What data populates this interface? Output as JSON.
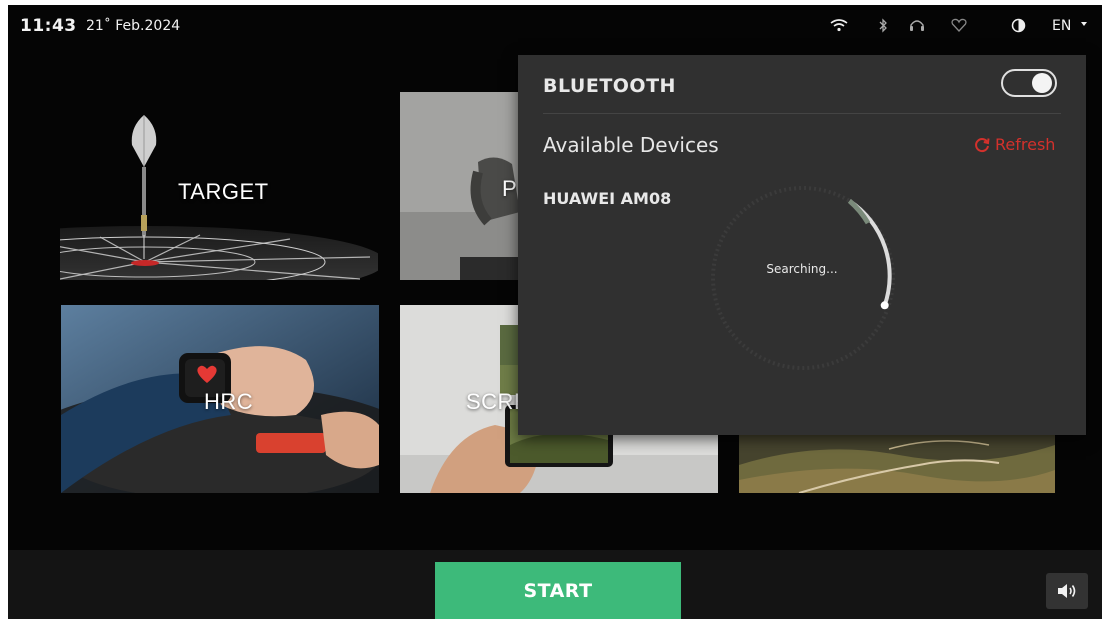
{
  "status_bar": {
    "time": "11:43",
    "date": "21˚ Feb.2024",
    "icons": [
      "wifi-icon",
      "bluetooth-icon",
      "headphones-icon",
      "heart-icon",
      "contrast-icon"
    ],
    "language": "EN"
  },
  "tiles": [
    {
      "label": "TARGET",
      "icon": "dart-target"
    },
    {
      "label": "P",
      "icon": "person-workout"
    },
    {
      "label": "HRC",
      "icon": "smartwatch-heart"
    },
    {
      "label": "SCRE",
      "icon": "phone-screen"
    },
    {
      "label": "",
      "icon": "mountain-road"
    }
  ],
  "bluetooth_panel": {
    "title": "BLUETOOTH",
    "enabled": true,
    "available_label": "Available Devices",
    "refresh_label": "Refresh",
    "devices": [
      "HUAWEI AM08"
    ],
    "searching_text": "Searching..."
  },
  "bottom_bar": {
    "start_label": "START",
    "volume_icon": "speaker-icon"
  },
  "colors": {
    "accent_green": "#3dba7a",
    "refresh_red": "#d3312c",
    "panel_bg": "#303030"
  }
}
